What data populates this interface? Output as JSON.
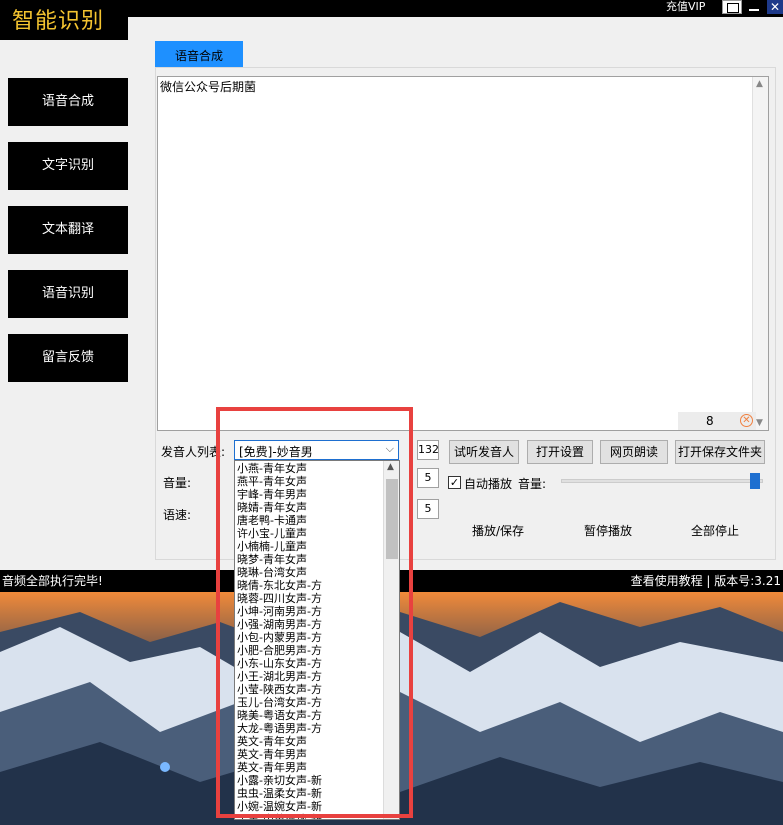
{
  "app": {
    "title": "智能识别",
    "vip_label": "充值VIP"
  },
  "sidebar": {
    "items": [
      {
        "label": "语音合成"
      },
      {
        "label": "文字识别"
      },
      {
        "label": "文本翻译"
      },
      {
        "label": "语音识别"
      },
      {
        "label": "留言反馈"
      }
    ]
  },
  "tab": {
    "label": "语音合成"
  },
  "editor": {
    "text": "微信公众号后期菌",
    "char_count": "8"
  },
  "voice": {
    "label": "发音人列表:",
    "selected": "[免费]-妙音男",
    "value_box": "132",
    "preview_button": "试听发音人",
    "settings_button": "打开设置",
    "web_read_button": "网页朗读",
    "open_folder_button": "打开保存文件夹"
  },
  "volume": {
    "label": "音量:",
    "value": "5"
  },
  "speed": {
    "label": "语速:",
    "value": "5"
  },
  "autoplay": {
    "label": "自动播放",
    "checked": true
  },
  "volume2": {
    "label": "音量:",
    "level": 0.95
  },
  "actions": {
    "play_save": "播放/保存",
    "pause": "暂停播放",
    "stop_all": "全部停止"
  },
  "dropdown": {
    "options": [
      "小燕-青年女声",
      "燕平-青年女声",
      "宇峰-青年男声",
      "晓婧-青年女声",
      "唐老鸭-卡通声",
      "许小宝-儿童声",
      "小楠楠-儿童声",
      "晓梦-青年女声",
      "晓琳-台湾女声",
      "晓倩-东北女声-方",
      "晓蓉-四川女声-方",
      "小坤-河南男声-方",
      "小强-湖南男声-方",
      "小包-内蒙男声-方",
      "小肥-合肥男声-方",
      "小东-山东女声-方",
      "小王-湖北男声-方",
      "小莹-陕西女声-方",
      "玉儿-台湾女声-方",
      "晓美-粤语女声-方",
      "大龙-粤语男声-方",
      "英文-青年女声",
      "英文-青年男声",
      "英文-青年男声",
      "小露-亲切女声-新",
      "虫虫-温柔女声-新",
      "小婉-温婉女声-新",
      "子墨-中英混读-新"
    ]
  },
  "status": {
    "left": "音频全部执行完毕!",
    "right": "查看使用教程 | 版本号:3.21"
  },
  "colors": {
    "accent": "#1e90ff",
    "highlight": "#e8413f",
    "logo": "#f4c430"
  }
}
